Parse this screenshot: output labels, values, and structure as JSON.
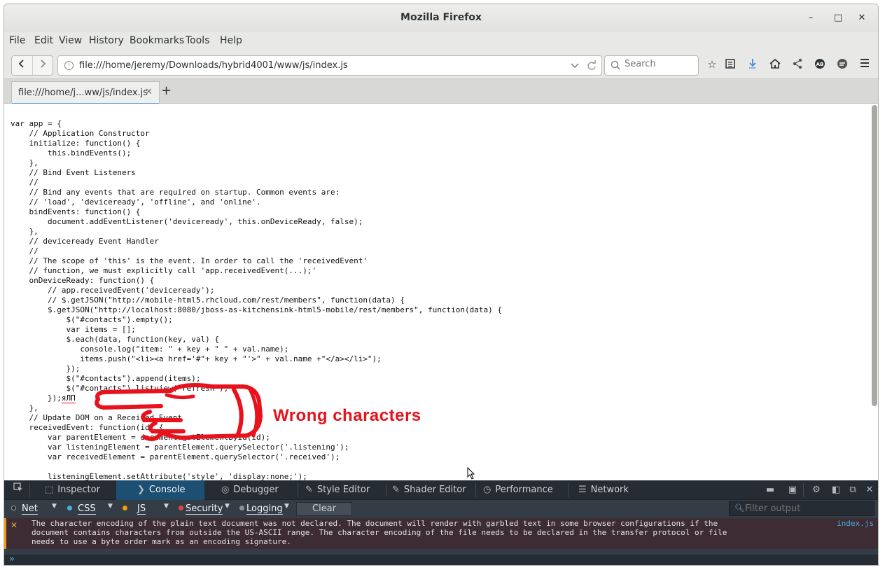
{
  "window": {
    "title": "Mozilla Firefox"
  },
  "window_controls": {
    "minimize": "–",
    "maximize": "□",
    "close": "✕"
  },
  "menubar": [
    "File",
    "Edit",
    "View",
    "History",
    "Bookmarks",
    "Tools",
    "Help"
  ],
  "navbar": {
    "url": "file:///home/jeremy/Downloads/hybrid4001/www/js/index.js",
    "search_placeholder": "Search"
  },
  "tabs": [
    {
      "title": "file:///home/j...ww/js/index.js",
      "active": true
    }
  ],
  "code_lines": [
    "var app = {",
    "    // Application Constructor",
    "    initialize: function() {",
    "        this.bindEvents();",
    "    },",
    "    // Bind Event Listeners",
    "    //",
    "    // Bind any events that are required on startup. Common events are:",
    "    // 'load', 'deviceready', 'offline', and 'online'.",
    "    bindEvents: function() {",
    "        document.addEventListener('deviceready', this.onDeviceReady, false);",
    "    },",
    "    // deviceready Event Handler",
    "    //",
    "    // The scope of 'this' is the event. In order to call the 'receivedEvent'",
    "    // function, we must explicitly call 'app.receivedEvent(...);'",
    "    onDeviceReady: function() {",
    "        // app.receivedEvent('deviceready');",
    "        // $.getJSON(\"http://mobile-html5.rhcloud.com/rest/members\", function(data) {",
    "        $.getJSON(\"http://localhost:8080/jboss-as-kitchensink-html5-mobile/rest/members\", function(data) {",
    "            $(\"#contacts\").empty();",
    "            var items = [];",
    "            $.each(data, function(key, val) {",
    "               console.log(\"item: \" + key + \" \" + val.name);",
    "               items.push(\"<li><a href='#\"+ key + \"'>\" + val.name +\"</a></li>\");",
    "            });",
    "            $(\"#contacts\").append(items);",
    "            $(\"#contacts\").listview(\"refresh\");",
    "        });яЛП",
    "    },",
    "    // Update DOM on a Received Event",
    "    receivedEvent: function(id) {",
    "        var parentElement = document.getElementById(id);",
    "        var listeningElement = parentElement.querySelector('.listening');",
    "        var receivedElement = parentElement.querySelector('.received');",
    "",
    "        listeningElement.setAttribute('style', 'display:none;');"
  ],
  "annotation": {
    "label": "Wrong characters"
  },
  "devtools": {
    "tabs": [
      "Inspector",
      "Console",
      "Debugger",
      "Style Editor",
      "Shader Editor",
      "Performance",
      "Network"
    ],
    "active_tab": "Console",
    "filters": {
      "net": "Net",
      "css": "CSS",
      "js": "JS",
      "security": "Security",
      "logging": "Logging",
      "clear": "Clear"
    },
    "filter_placeholder": "Filter output",
    "message": {
      "text": "The character encoding of the plain text document was not declared. The document will render with garbled text in some browser configurations if the\ndocument contains characters from outside the US-ASCII range. The character encoding of the file needs to be declared in the transfer protocol or file\nneeds to use a byte order mark as an encoding signature.",
      "location": "index.js"
    },
    "prompt": "»"
  },
  "colors": {
    "annotation_red": "#e8121c",
    "devtools_bg": "#343c45",
    "devtools_active_tab": "#1d4f73",
    "error_border": "#f39c12",
    "link_blue": "#46afe3"
  }
}
